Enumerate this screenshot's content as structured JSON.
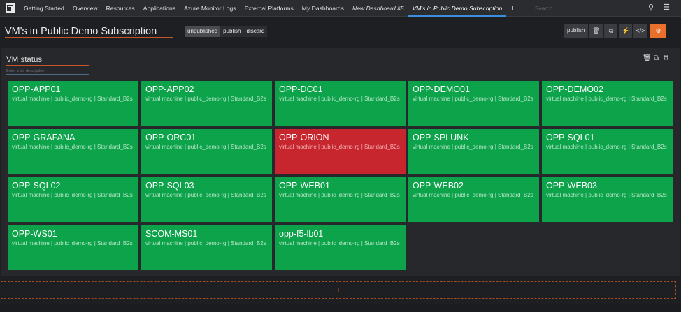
{
  "nav": {
    "items": [
      {
        "label": "Getting Started",
        "style": "normal"
      },
      {
        "label": "Overview",
        "style": "normal"
      },
      {
        "label": "Resources",
        "style": "normal"
      },
      {
        "label": "Applications",
        "style": "normal"
      },
      {
        "label": "Azure Monitor Logs",
        "style": "normal"
      },
      {
        "label": "External Platforms",
        "style": "normal"
      },
      {
        "label": "My Dashboards",
        "style": "normal"
      },
      {
        "label": "New Dashboard #5",
        "style": "italic"
      },
      {
        "label": "VM's in Public Demo Subscription",
        "style": "active"
      }
    ],
    "add_label": "+",
    "search_placeholder": "Search...",
    "search_icon": "search-icon",
    "menu_icon": "hamburger-menu-icon"
  },
  "header": {
    "dashboard_title": "VM's in Public Demo Subscription",
    "status": {
      "unpublished": "unpublished",
      "publish": "publish",
      "discard": "discard"
    },
    "toolbar": {
      "publish_label": "publish",
      "icons": [
        "delete-icon",
        "copy-icon",
        "bolt-icon",
        "code-icon",
        "settings-icon"
      ],
      "settings_color": "#e8702b"
    }
  },
  "panel": {
    "tile_title": "VM status",
    "description_placeholder": "Enter a tile description",
    "icons": [
      "delete-icon",
      "copy-icon",
      "gear-icon"
    ]
  },
  "tiles": [
    {
      "name": "OPP-APP01",
      "subtitle": "virtual machine | public_demo-rg | Standard_B2s",
      "status": "ok"
    },
    {
      "name": "OPP-APP02",
      "subtitle": "virtual machine | public_demo-rg | Standard_B2s",
      "status": "ok"
    },
    {
      "name": "OPP-DC01",
      "subtitle": "virtual machine | public_demo-rg | Standard_B2s",
      "status": "ok"
    },
    {
      "name": "OPP-DEMO01",
      "subtitle": "virtual machine | public_demo-rg | Standard_B2s",
      "status": "ok"
    },
    {
      "name": "OPP-DEMO02",
      "subtitle": "virtual machine | public_demo-rg | Standard_B2s",
      "status": "ok"
    },
    {
      "name": "OPP-GRAFANA",
      "subtitle": "virtual machine | public_demo-rg | Standard_B2s",
      "status": "ok"
    },
    {
      "name": "OPP-ORC01",
      "subtitle": "virtual machine | public_demo-rg | Standard_B2s",
      "status": "ok"
    },
    {
      "name": "OPP-ORION",
      "subtitle": "virtual machine | public_demo-rg | Standard_B2s",
      "status": "error"
    },
    {
      "name": "OPP-SPLUNK",
      "subtitle": "virtual machine | public_demo-rg | Standard_B2s",
      "status": "ok"
    },
    {
      "name": "OPP-SQL01",
      "subtitle": "virtual machine | public_demo-rg | Standard_B2s",
      "status": "ok"
    },
    {
      "name": "OPP-SQL02",
      "subtitle": "virtual machine | public_demo-rg | Standard_B2s",
      "status": "ok"
    },
    {
      "name": "OPP-SQL03",
      "subtitle": "virtual machine | public_demo-rg | Standard_B2s",
      "status": "ok"
    },
    {
      "name": "OPP-WEB01",
      "subtitle": "virtual machine | public_demo-rg | Standard_B2s",
      "status": "ok"
    },
    {
      "name": "OPP-WEB02",
      "subtitle": "virtual machine | public_demo-rg | Standard_B2s",
      "status": "ok"
    },
    {
      "name": "OPP-WEB03",
      "subtitle": "virtual machine | public_demo-rg | Standard_B2s",
      "status": "ok"
    },
    {
      "name": "OPP-WS01",
      "subtitle": "virtual machine | public_demo-rg | Standard_B2s",
      "status": "ok"
    },
    {
      "name": "SCOM-MS01",
      "subtitle": "virtual machine | public_demo-rg | Standard_B2s",
      "status": "ok"
    },
    {
      "name": "opp-f5-lb01",
      "subtitle": "virtual machine | public_demo-rg | Standard_B2s",
      "status": "ok"
    }
  ],
  "colors": {
    "ok": "#0ca34a",
    "error": "#c8262e",
    "accent": "#e8702b"
  },
  "add_tile_label": "+"
}
